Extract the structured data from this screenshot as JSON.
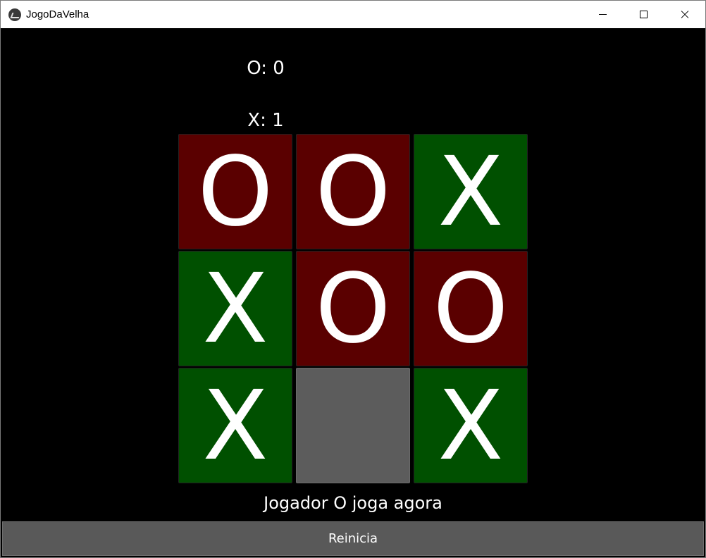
{
  "window": {
    "title": "JogoDaVelha",
    "icon": "kivy-app-icon",
    "controls": [
      "minimize-icon",
      "maximize-icon",
      "close-icon"
    ]
  },
  "scores": {
    "o": "O: 0",
    "x": "X: 1"
  },
  "board": {
    "cells": [
      "O",
      "O",
      "X",
      "X",
      "O",
      "O",
      "X",
      "",
      "X"
    ]
  },
  "colors": {
    "o_cell": "#5a0000",
    "x_cell": "#005000",
    "empty_cell": "#5c5c5c",
    "background": "#000000",
    "button": "#595959"
  },
  "status": "Jogador O joga agora",
  "restart_label": "Reinicia"
}
